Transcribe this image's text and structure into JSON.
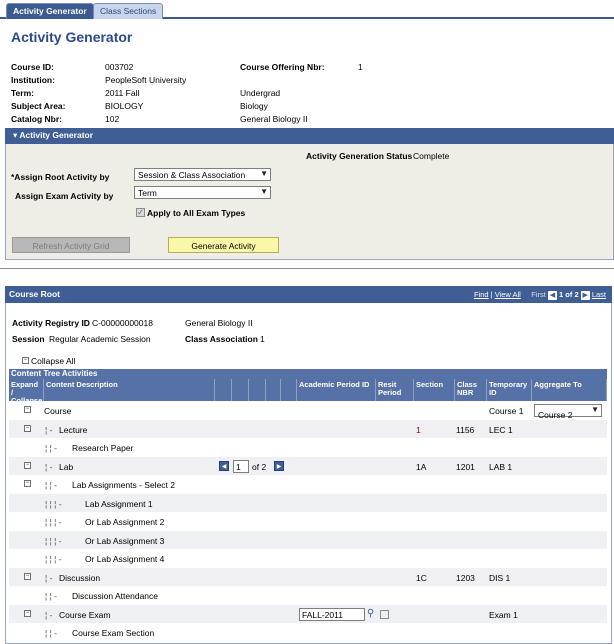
{
  "tabs": [
    {
      "label": "Activity Generator",
      "active": true
    },
    {
      "label": "Class Sections",
      "active": false
    }
  ],
  "page_title": "Activity Generator",
  "header": {
    "course_id_label": "Course ID:",
    "course_id": "003702",
    "course_offering_label": "Course Offering Nbr:",
    "course_offering": "1",
    "institution_label": "Institution:",
    "institution": "PeopleSoft University",
    "term_label": "Term:",
    "term": "2011 Fall",
    "career": "Undergrad",
    "subject_label": "Subject Area:",
    "subject": "BIOLOGY",
    "subject_desc": "Biology",
    "catalog_label": "Catalog Nbr:",
    "catalog": "102",
    "catalog_desc": "General Biology II"
  },
  "generator": {
    "title": "Activity Generator",
    "status_label": "Activity Generation Status",
    "status": "Complete",
    "root_label": "*Assign Root Activity by",
    "root_value": "Session & Class Association",
    "exam_label": "Assign Exam Activity by",
    "exam_value": "Term",
    "apply_label": "Apply to All Exam Types",
    "refresh_button": "Refresh Activity Grid",
    "generate_button": "Generate Activity"
  },
  "course_root": {
    "title": "Course Root",
    "find": "Find",
    "view_all": "View All",
    "first": "First",
    "pager": "1 of 2",
    "last": "Last",
    "registry_label": "Activity Registry ID",
    "registry_id": "C-00000000018",
    "registry_desc": "General Biology II",
    "session_label": "Session",
    "session": "Regular Academic Session",
    "class_assoc_label": "Class Association",
    "class_assoc": "1",
    "collapse_all": "Collapse All",
    "grid_title": "Content Tree Activities",
    "columns": {
      "expand": "Expand / Collapse",
      "desc": "Content Description",
      "period": "Academic Period ID",
      "result": "Resit Period",
      "section": "Section",
      "nbr": "Class NBR",
      "temp": "Temporary ID",
      "agg": "Aggregate To"
    },
    "rows": [
      {
        "desc": "Course",
        "prefix": "",
        "section": "",
        "nbr": "",
        "temp": "Course 1",
        "agg": "Course 2"
      },
      {
        "desc": "Lecture",
        "prefix": "¦ -",
        "section": "1",
        "nbr": "1156",
        "temp": "LEC 1"
      },
      {
        "desc": "Research Paper",
        "prefix": "¦   ¦ -",
        "section": "",
        "nbr": "",
        "temp": ""
      },
      {
        "desc": "Lab",
        "prefix": "¦ -",
        "section": "1A",
        "nbr": "1201",
        "temp": "LAB 1",
        "pager_value": "1",
        "pager_of": "of 2"
      },
      {
        "desc": "Lab Assignments - Select 2",
        "prefix": "¦   ¦ -",
        "section": "",
        "nbr": "",
        "temp": ""
      },
      {
        "desc": "Lab Assignment 1",
        "prefix": "¦   ¦   ¦ -",
        "section": "",
        "nbr": "",
        "temp": ""
      },
      {
        "desc": "Or Lab Assignment 2",
        "prefix": "¦   ¦   ¦ -",
        "section": "",
        "nbr": "",
        "temp": ""
      },
      {
        "desc": "Or Lab Assignment 3",
        "prefix": "¦   ¦   ¦ -",
        "section": "",
        "nbr": "",
        "temp": ""
      },
      {
        "desc": "Or Lab Assignment 4",
        "prefix": "¦   ¦   ¦ -",
        "section": "",
        "nbr": "",
        "temp": ""
      },
      {
        "desc": "Discussion",
        "prefix": "¦ -",
        "section": "1C",
        "nbr": "1203",
        "temp": "DIS 1"
      },
      {
        "desc": "Discussion Attendance",
        "prefix": "¦   ¦ -",
        "section": "",
        "nbr": "",
        "temp": ""
      },
      {
        "desc": "Course Exam",
        "prefix": "¦ -",
        "section": "",
        "nbr": "",
        "temp": "Exam 1",
        "period": "FALL-2011"
      },
      {
        "desc": "Course Exam Section",
        "prefix": "¦   ¦ -",
        "section": "",
        "nbr": "",
        "temp": ""
      }
    ]
  }
}
